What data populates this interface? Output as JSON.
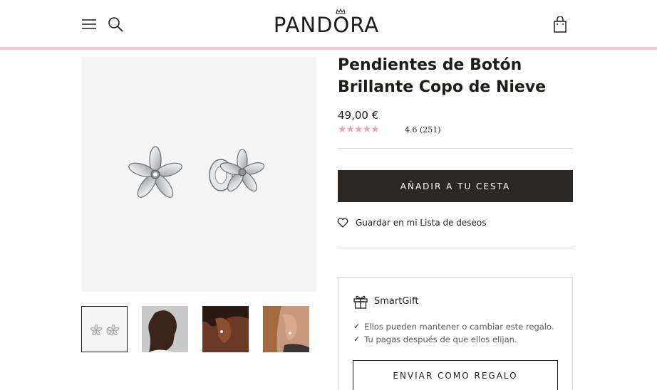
{
  "header": {
    "logo_text": "PANDORA",
    "menu_icon": "menu-icon",
    "search_icon": "search-icon",
    "cart_icon": "shopping-bag-icon",
    "accent_bar_color": "#f3c9d1"
  },
  "gallery": {
    "main_image": "sparkling-snowflake-stud-earrings",
    "thumbnails": [
      {
        "name": "earrings-product-thumbnail",
        "active": true
      },
      {
        "name": "model-profile-thumbnail",
        "active": false
      },
      {
        "name": "ear-closeup-dark-thumbnail",
        "active": false
      },
      {
        "name": "ear-closeup-light-thumbnail",
        "active": false
      }
    ]
  },
  "product": {
    "title": "Pendientes de Botón Brillante Copo de Nieve",
    "price": "49,00 €",
    "stars": "★★★★★",
    "rating_text": "4.6 (251)",
    "rating_value": 4.6,
    "review_count": 251,
    "star_color": "#f0a4b3"
  },
  "actions": {
    "add_to_cart_label": "AÑADIR A TU CESTA",
    "wishlist_label": "Guardar en mi Lista de deseos",
    "button_color": "#2b2724"
  },
  "smartgift": {
    "title": "SmartGift",
    "lines": [
      "Ellos pueden mantener o cambiar este regalo.",
      "Tu pagas después de que ellos elijan."
    ],
    "button_label": "ENVIAR COMO REGALO"
  }
}
